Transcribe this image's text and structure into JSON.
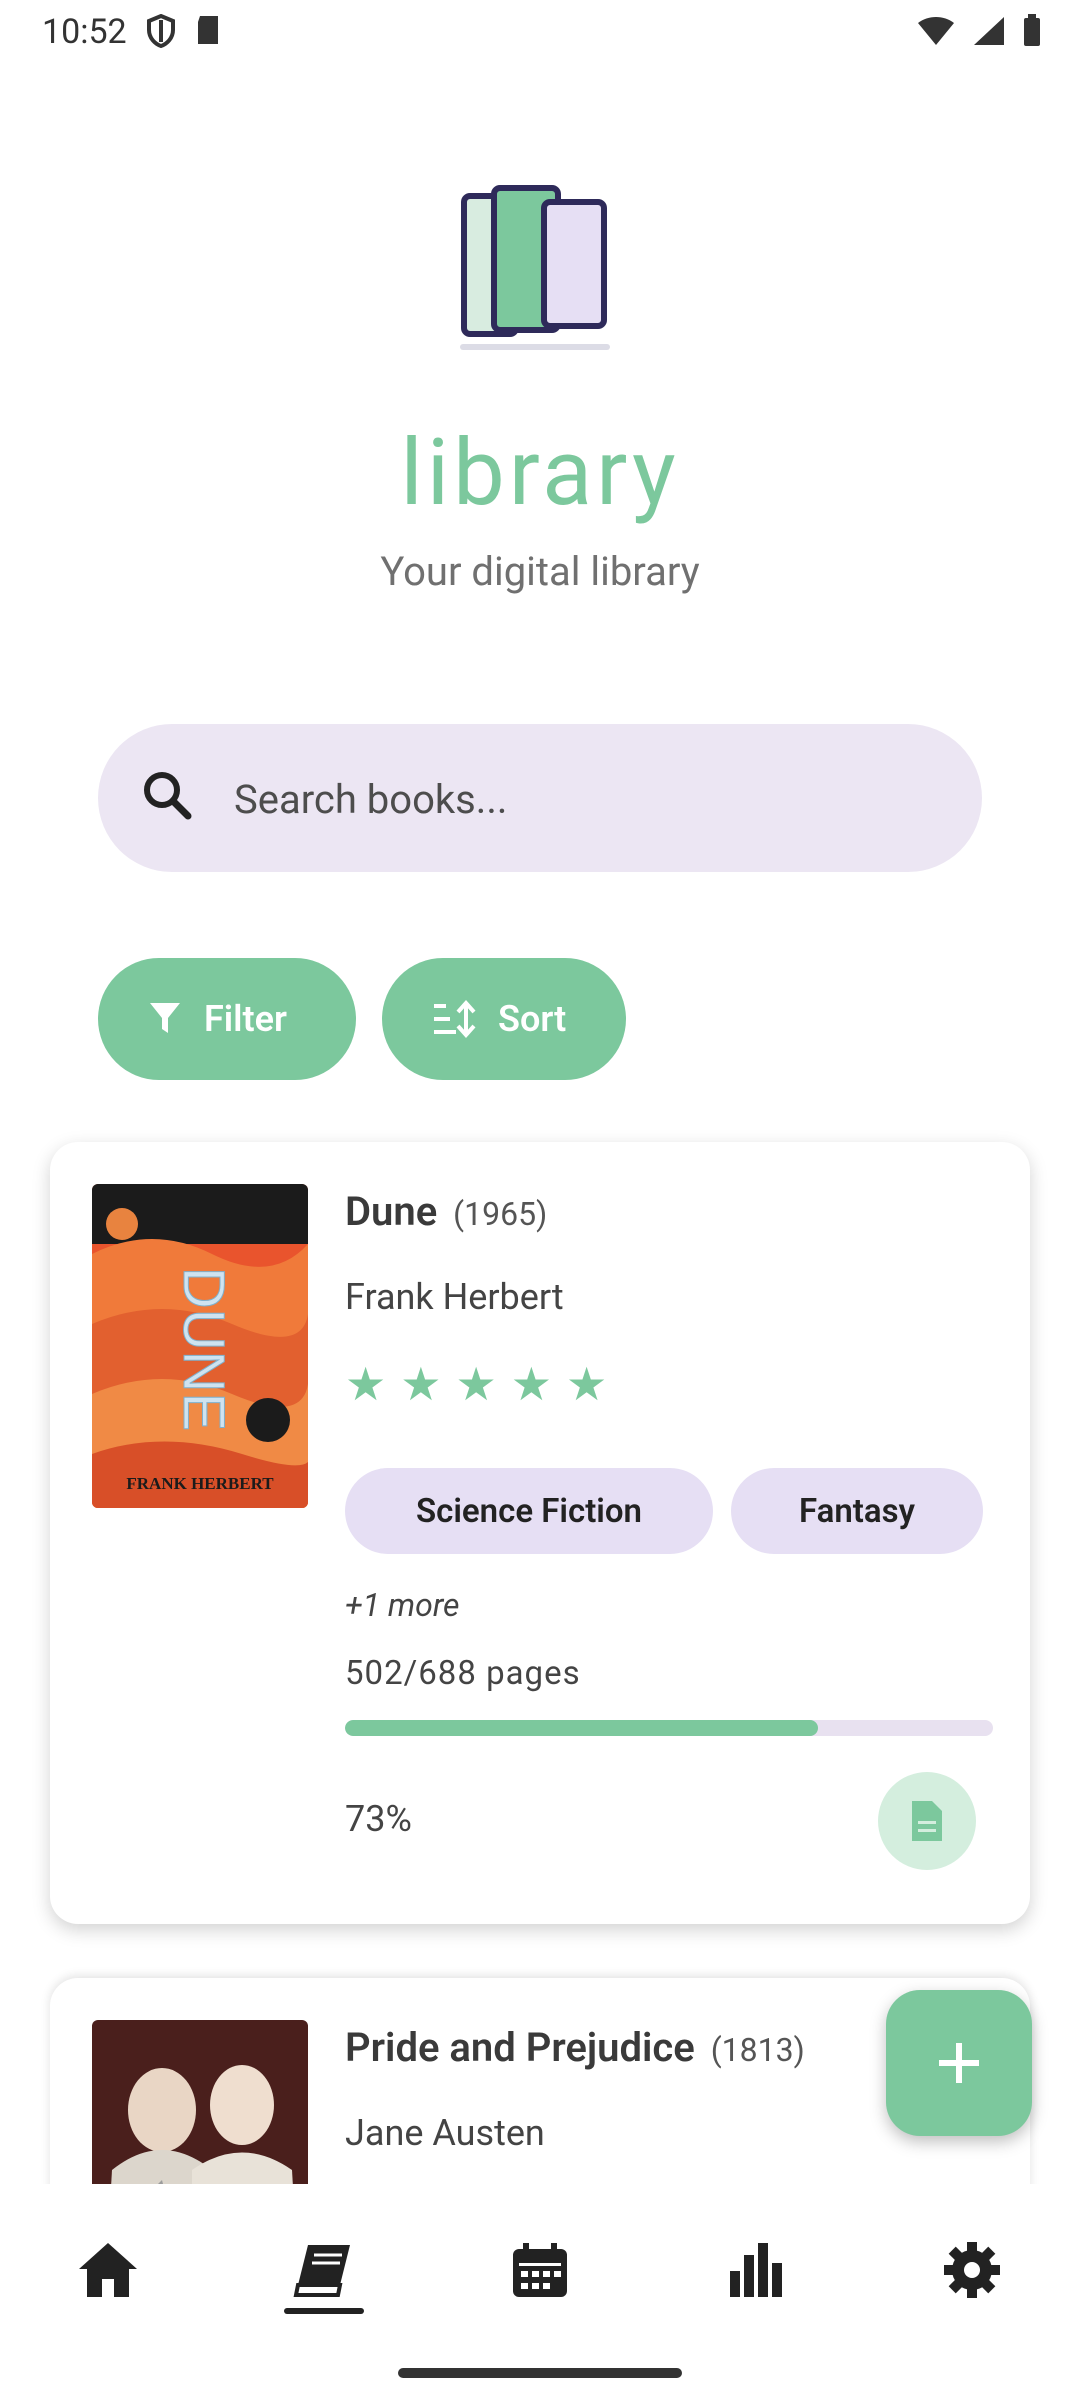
{
  "status_bar": {
    "time": "10:52"
  },
  "header": {
    "app_title": "library",
    "subtitle": "Your digital library"
  },
  "search": {
    "placeholder": "Search books...",
    "value": ""
  },
  "controls": {
    "filter_label": "Filter",
    "sort_label": "Sort"
  },
  "books": [
    {
      "title": "Dune",
      "year": "(1965)",
      "author": "Frank Herbert",
      "rating": 5,
      "genres": [
        "Science Fiction",
        "Fantasy"
      ],
      "more": "+1 more",
      "pages_text": "502/688 pages",
      "progress_fraction": 0.73,
      "percent_text": "73%",
      "cover_text": "DUNE",
      "cover_author": "FRANK HERBERT"
    },
    {
      "title": "Pride and Prejudice",
      "year": "(1813)",
      "author": "Jane Austen"
    }
  ],
  "colors": {
    "accent": "#7cc89d",
    "chip": "#e6dff4",
    "search_bg": "#ece6f3"
  },
  "nav": [
    {
      "name": "home-icon"
    },
    {
      "name": "book-icon",
      "active": true
    },
    {
      "name": "calendar-icon"
    },
    {
      "name": "stats-icon"
    },
    {
      "name": "gear-icon"
    }
  ]
}
